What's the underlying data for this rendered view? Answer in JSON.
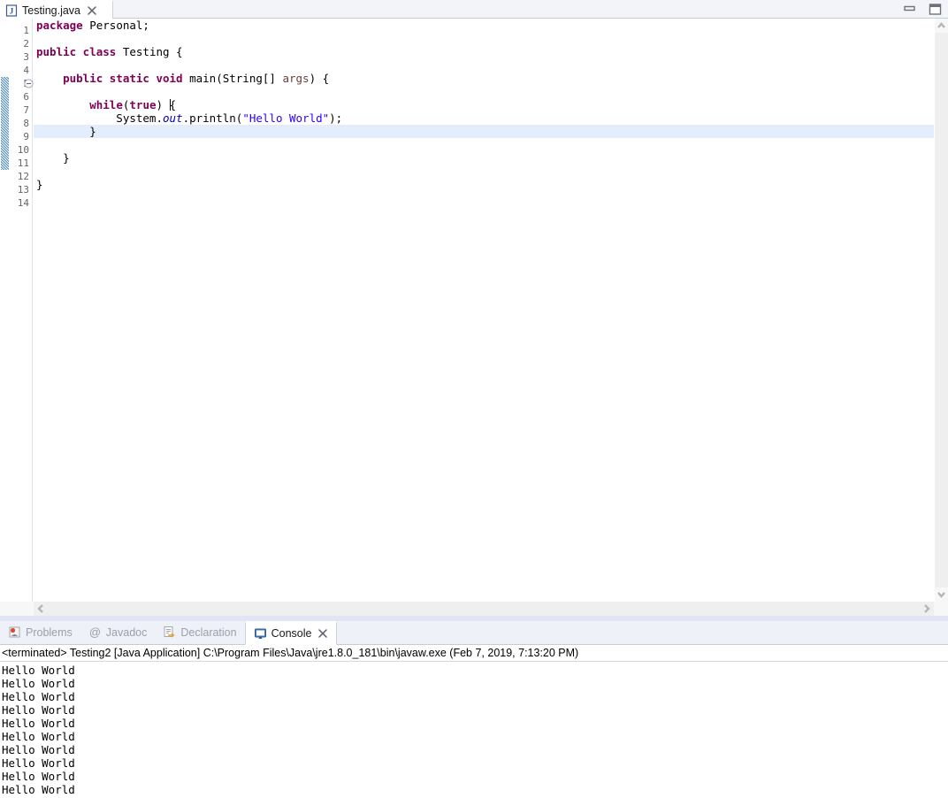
{
  "window": {
    "minimize_label": "Minimize",
    "restore_label": "Restore"
  },
  "editor": {
    "tab": {
      "title": "Testing.java",
      "icon": "java-file-icon",
      "close_icon": "close-icon"
    },
    "active_line": 9,
    "change_bar_lines": [
      5,
      6,
      7,
      8,
      9,
      10,
      11
    ],
    "fold_marker_line": 5,
    "gutter_numbers": [
      "1",
      "2",
      "3",
      "4",
      "5",
      "6",
      "7",
      "8",
      "9",
      "10",
      "11",
      "12",
      "13",
      "14"
    ],
    "lines": [
      {
        "n": 1,
        "tokens": [
          {
            "t": "package ",
            "c": "kw"
          },
          {
            "t": "Personal;",
            "c": "plain"
          }
        ]
      },
      {
        "n": 2,
        "tokens": []
      },
      {
        "n": 3,
        "tokens": [
          {
            "t": "public class ",
            "c": "kw"
          },
          {
            "t": "Testing {",
            "c": "plain"
          }
        ]
      },
      {
        "n": 4,
        "tokens": []
      },
      {
        "n": 5,
        "tokens": [
          {
            "t": "    public static void ",
            "c": "kw"
          },
          {
            "t": "main(String[] ",
            "c": "plain"
          },
          {
            "t": "args",
            "c": "param"
          },
          {
            "t": ") {",
            "c": "plain"
          }
        ]
      },
      {
        "n": 6,
        "tokens": []
      },
      {
        "n": 7,
        "tokens": [
          {
            "t": "        ",
            "c": "plain"
          },
          {
            "t": "while",
            "c": "kw"
          },
          {
            "t": "(",
            "c": "plain"
          },
          {
            "t": "true",
            "c": "kw"
          },
          {
            "t": ") ",
            "c": "plain"
          },
          {
            "t": "{",
            "c": "plain",
            "caret": true
          }
        ]
      },
      {
        "n": 8,
        "tokens": [
          {
            "t": "            System.",
            "c": "plain"
          },
          {
            "t": "out",
            "c": "field"
          },
          {
            "t": ".println(",
            "c": "plain"
          },
          {
            "t": "\"Hello World\"",
            "c": "str"
          },
          {
            "t": ");",
            "c": "plain"
          }
        ]
      },
      {
        "n": 9,
        "tokens": [
          {
            "t": "        }",
            "c": "plain"
          }
        ]
      },
      {
        "n": 10,
        "tokens": []
      },
      {
        "n": 11,
        "tokens": [
          {
            "t": "    }",
            "c": "plain"
          }
        ]
      },
      {
        "n": 12,
        "tokens": []
      },
      {
        "n": 13,
        "tokens": [
          {
            "t": "}",
            "c": "plain"
          }
        ]
      },
      {
        "n": 14,
        "tokens": []
      }
    ],
    "vscroll": {
      "up_icon": "chevron-up-icon",
      "down_icon": "chevron-down-icon"
    },
    "hscroll": {
      "left_icon": "chevron-left-icon",
      "right_icon": "chevron-right-icon"
    }
  },
  "bottom_panel": {
    "tabs": [
      {
        "label": "Problems",
        "icon": "problems-icon",
        "active": false
      },
      {
        "label": "Javadoc",
        "icon": "javadoc-at-icon",
        "active": false
      },
      {
        "label": "Declaration",
        "icon": "declaration-icon",
        "active": false
      },
      {
        "label": "Console",
        "icon": "console-icon",
        "active": true,
        "close_icon": "close-icon"
      }
    ],
    "console": {
      "header": "<terminated> Testing2 [Java Application] C:\\Program Files\\Java\\jre1.8.0_181\\bin\\javaw.exe (Feb 7, 2019, 7:13:20 PM)",
      "output_lines": [
        "Hello World",
        "Hello World",
        "Hello World",
        "Hello World",
        "Hello World",
        "Hello World",
        "Hello World",
        "Hello World",
        "Hello World",
        "Hello World"
      ]
    }
  },
  "colors": {
    "keyword": "#7f0055",
    "string": "#2a00ff",
    "static_field": "#0000c0",
    "parameter": "#6a3e3e",
    "line_highlight": "#e4edfb",
    "change_bar": "#2a74c8",
    "tabbar_bg": "#f2f4f9",
    "inactive_tab_text": "#9aa0ab"
  }
}
